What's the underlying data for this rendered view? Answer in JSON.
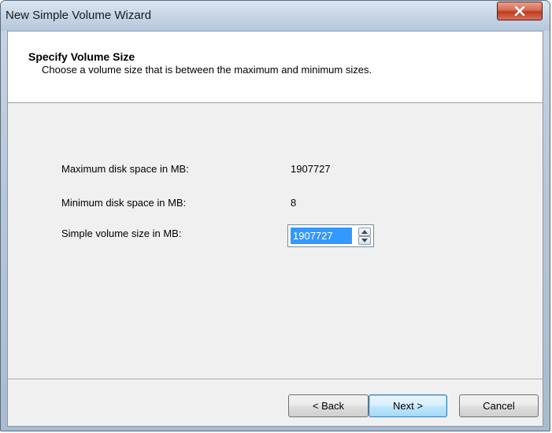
{
  "window": {
    "title": "New Simple Volume Wizard"
  },
  "header": {
    "title": "Specify Volume Size",
    "subtitle": "Choose a volume size that is between the maximum and minimum sizes."
  },
  "fields": {
    "max_label": "Maximum disk space in MB:",
    "max_value": "1907727",
    "min_label": "Minimum disk space in MB:",
    "min_value": "8",
    "size_label": "Simple volume size in MB:",
    "size_value": "1907727"
  },
  "buttons": {
    "back": "< Back",
    "next": "Next >",
    "cancel": "Cancel"
  },
  "icons": {
    "close": "close-icon",
    "spin_up": "arrow-up-icon",
    "spin_down": "arrow-down-icon"
  },
  "colors": {
    "selection": "#3399ff",
    "close_button": "#c03b1e"
  }
}
